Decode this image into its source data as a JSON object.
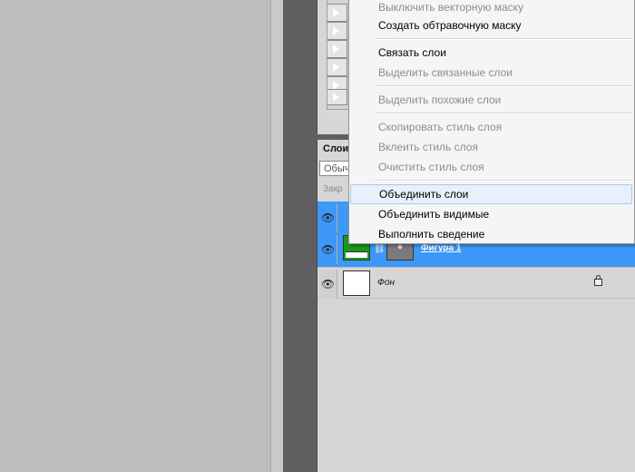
{
  "menu": {
    "items": [
      {
        "label": "Выключить векторную маску",
        "disabled": true
      },
      {
        "label": "Создать обтравочную маску",
        "disabled": false
      },
      {
        "label": "Связать слои",
        "disabled": false
      },
      {
        "label": "Выделить связанные слои",
        "disabled": true
      },
      {
        "label": "Выделить похожие слои",
        "disabled": true
      },
      {
        "label": "Скопировать стиль слоя",
        "disabled": true
      },
      {
        "label": "Вклеить стиль слоя",
        "disabled": true
      },
      {
        "label": "Очистить стиль слоя",
        "disabled": true
      },
      {
        "label": "Объединить слои",
        "disabled": false,
        "highlighted": true
      },
      {
        "label": "Объединить видимые",
        "disabled": false
      },
      {
        "label": "Выполнить сведение",
        "disabled": false
      }
    ]
  },
  "layers_panel": {
    "tab_label": "Слои",
    "blend_mode": "Обычные",
    "lock_label": "Закр",
    "layers": [
      {
        "name": "Фигура 1",
        "selected": true,
        "thumb_color": "#1a9a1a",
        "mask_color": "#7a7a7a"
      },
      {
        "name": "Фон",
        "selected": false,
        "thumb_color": "#ffffff",
        "locked": true
      }
    ]
  },
  "colors": {
    "selection": "#3d98f7",
    "menu_hover": "#e7f0fb",
    "panel_bg": "#d6d6d6"
  }
}
